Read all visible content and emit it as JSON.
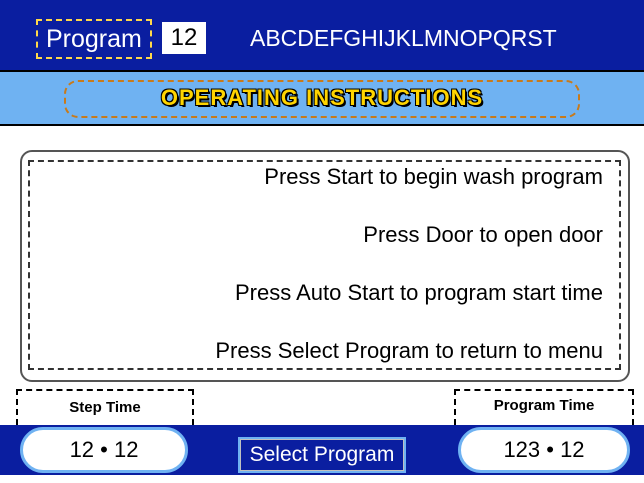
{
  "header": {
    "program_label": "Program",
    "program_number": "12",
    "program_name": "ABCDEFGHIJKLMNOPQRST"
  },
  "title": "OPERATING INSTRUCTIONS",
  "instructions": [
    "Press Start to begin wash program",
    "Press Door to open door",
    "Press Auto Start to program start time",
    "Press Select Program to return to menu"
  ],
  "footer": {
    "step_time_label": "Step Time",
    "step_time_value": "12 • 12",
    "program_time_label": "Program Time",
    "program_time_value": "123 • 12",
    "select_program_label": "Select Program"
  },
  "colors": {
    "bar_blue": "#0a1ea0",
    "light_blue": "#6fb2f2",
    "title_yellow": "#ffd400"
  }
}
